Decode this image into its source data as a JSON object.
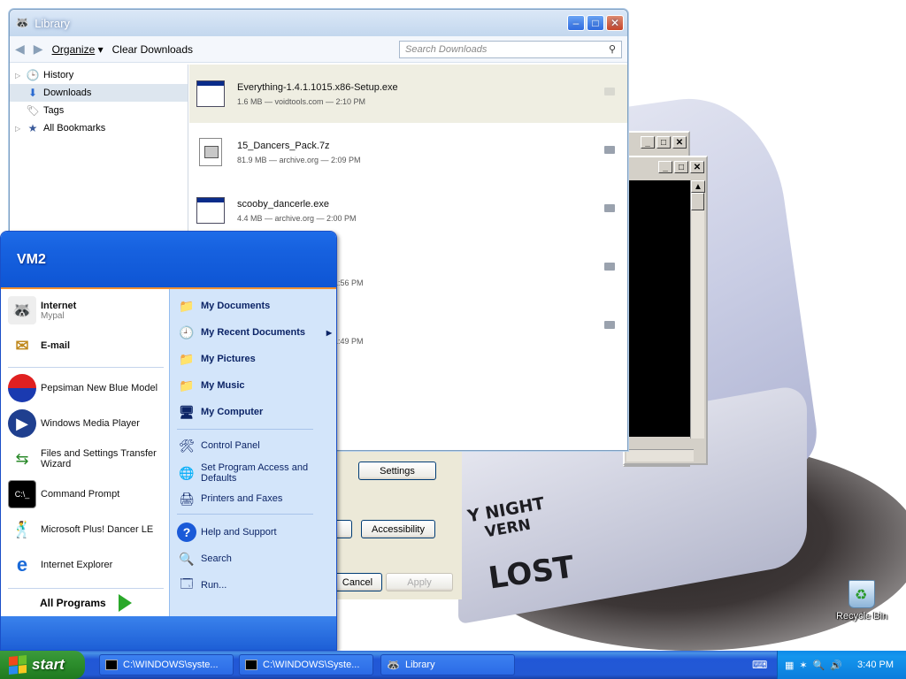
{
  "library": {
    "title": "Library",
    "toolbar": {
      "organize": "Organize",
      "clear": "Clear Downloads",
      "search_placeholder": "Search Downloads"
    },
    "sidebar": [
      {
        "label": "History",
        "icon": "clock-icon"
      },
      {
        "label": "Downloads",
        "icon": "download-arrow-icon"
      },
      {
        "label": "Tags",
        "icon": "tag-icon"
      },
      {
        "label": "All Bookmarks",
        "icon": "bookmarks-icon"
      }
    ],
    "downloads": [
      {
        "name": "Everything-1.4.1.1015.x86-Setup.exe",
        "meta": "1.6 MB — voidtools.com — 2:10 PM"
      },
      {
        "name": "15_Dancers_Pack.7z",
        "meta": "81.9 MB — archive.org — 2:09 PM"
      },
      {
        "name": "scooby_dancerle.exe",
        "meta": "4.4 MB — archive.org — 2:00 PM"
      },
      {
        "partial_time": "1:56 PM"
      },
      {
        "partial_time": "1:49 PM"
      }
    ]
  },
  "props_dialog": {
    "settings": "Settings",
    "accessibility": "Accessibility",
    "cancel": "Cancel",
    "apply": "Apply"
  },
  "start_menu": {
    "user": "VM2",
    "pinned": [
      {
        "title": "Internet",
        "sub": "Mypal"
      },
      {
        "title": "E-mail"
      }
    ],
    "recent": [
      "Pepsiman New Blue Model",
      "Windows Media Player",
      "Files and Settings Transfer Wizard",
      "Command Prompt",
      "Microsoft Plus! Dancer LE",
      "Internet Explorer"
    ],
    "all_programs": "All Programs",
    "places": [
      "My Documents",
      "My Recent Documents",
      "My Pictures",
      "My Music",
      "My Computer"
    ],
    "system": [
      "Control Panel",
      "Set Program Access and Defaults",
      "Printers and Faxes"
    ],
    "help": [
      "Help and Support",
      "Search",
      "Run..."
    ]
  },
  "wallpaper_text": [
    "Y NIGHT",
    "VERN",
    "LOST"
  ],
  "desktop": {
    "recycle_bin": "Recycle Bin"
  },
  "taskbar": {
    "start": "start",
    "tasks": [
      "C:\\WINDOWS\\syste...",
      "C:\\WINDOWS\\Syste...",
      "Library"
    ],
    "clock": "3:40 PM"
  }
}
